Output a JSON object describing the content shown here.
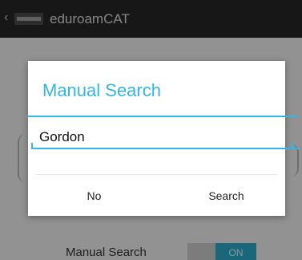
{
  "action_bar": {
    "title": "eduroamCAT",
    "up_icon": "chevron-left-icon",
    "logo_icon": "eduroam-logo-icon"
  },
  "background": {
    "manual_search_label": "Manual Search",
    "toggle_state": "ON"
  },
  "dialog": {
    "title": "Manual Search",
    "search_value": "Gordon",
    "no_label": "No",
    "search_label": "Search"
  },
  "colors": {
    "accent": "#33b5e5",
    "action_bar": "#262626",
    "toggle_on": "#2aa7c7"
  }
}
